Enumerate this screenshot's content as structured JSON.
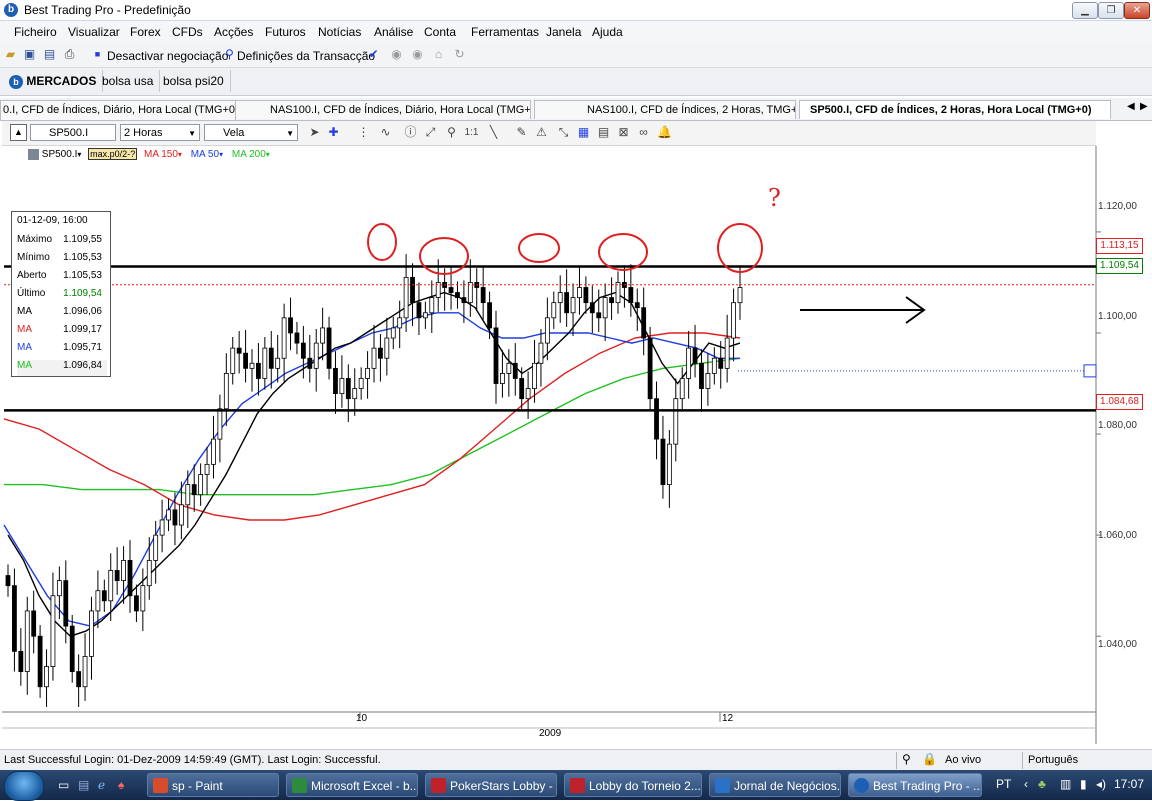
{
  "window": {
    "title": "Best Trading Pro - Predefinição",
    "app_logo": "b"
  },
  "menu": [
    "Ficheiro",
    "Visualizar",
    "Forex",
    "CFDs",
    "Acções",
    "Futuros",
    "Notícias",
    "Análise",
    "Conta",
    "Ferramentas",
    "Janela",
    "Ajuda"
  ],
  "toolbar": {
    "deactivate_label": "Desactivar negociação",
    "transaction_label": "Definições da Transacção"
  },
  "markets": {
    "logo_label": "MERCADOS",
    "tabs": [
      "bolsa usa",
      "bolsa psi20"
    ]
  },
  "chart_tabs": [
    "0.I, CFD de Índices, Diário, Hora Local (TMG+0)",
    "NAS100.I, CFD de Índices, Diário, Hora Local (TMG+0)",
    "NAS100.I, CFD de Índices, 2 Horas, TMG+0",
    "SP500.I, CFD de Índices, 2 Horas, Hora Local (TMG+0)"
  ],
  "chart_toolbar": {
    "symbol": "SP500.I",
    "timeframe": "2 Horas",
    "chart_type": "Vela"
  },
  "legend": {
    "symbol": "SP500.I",
    "overlay": "max.p0/2-?",
    "items": [
      {
        "label": "MA 20",
        "color": "#000000"
      },
      {
        "label": "MA 150",
        "color": "#e02020"
      },
      {
        "label": "MA 50",
        "color": "#1f3de0"
      },
      {
        "label": "MA 200",
        "color": "#20c020"
      }
    ]
  },
  "info": {
    "date": "01-12-09, 16:00",
    "rows": [
      {
        "label": "Máximo",
        "value": "1.109,55",
        "color": "#000000"
      },
      {
        "label": "Mínimo",
        "value": "1.105,53",
        "color": "#000000"
      },
      {
        "label": "Aberto",
        "value": "1.105,53",
        "color": "#000000"
      },
      {
        "label": "Último",
        "value": "1.109,54",
        "color": "#008000"
      },
      {
        "label": "MA",
        "value": "1.096,06",
        "color": "#000000"
      },
      {
        "label": "MA",
        "value": "1.099,17",
        "color": "#e02020"
      },
      {
        "label": "MA",
        "value": "1.095,71",
        "color": "#1f3de0"
      },
      {
        "label": "MA",
        "value": "1.096,84",
        "color": "#20c020"
      }
    ]
  },
  "price_axis": [
    "1.120,00",
    "1.100,00",
    "1.080,00",
    "1.060,00",
    "1.040,00"
  ],
  "price_markers": [
    {
      "value": "1.113,15",
      "color": "#e02020"
    },
    {
      "value": "1.109,54",
      "color": "#008000"
    },
    {
      "value": "1.084,68",
      "color": "#e02020"
    }
  ],
  "time_axis": {
    "labels": [
      "10",
      "12"
    ],
    "year": "2009"
  },
  "annotation": {
    "question": "?"
  },
  "status": {
    "login": "Last Successful Login: 01-Dez-2009 14:59:49 (GMT). Last Login: Successful.",
    "mode": "Ao vivo",
    "language": "Português"
  },
  "taskbar": {
    "items": [
      {
        "label": "sp - Paint",
        "color": "#d84c2c"
      },
      {
        "label": "Microsoft Excel - b...",
        "color": "#2e8b3e"
      },
      {
        "label": "PokerStars Lobby - ...",
        "color": "#c0222a"
      },
      {
        "label": "Lobby do Torneio 2...",
        "color": "#c0222a"
      },
      {
        "label": "Jornal de Negócios...",
        "color": "#2a72c8"
      },
      {
        "label": "Best Trading Pro - ...",
        "color": "#1e5fb4"
      }
    ],
    "lang": "PT",
    "clock": "17:07"
  },
  "chart_data": {
    "type": "candlestick",
    "symbol": "SP500.I",
    "timeframe": "2 Horas",
    "ylim": [
      1025,
      1137
    ],
    "resistance": 1113.15,
    "support": 1084.68,
    "last": 1109.54,
    "target_line": 1092.5,
    "closes": [
      1050,
      1037,
      1033,
      1045,
      1040,
      1030,
      1034,
      1048,
      1051,
      1042,
      1033,
      1030,
      1036,
      1045,
      1049,
      1047,
      1053,
      1051,
      1055,
      1048,
      1045,
      1050,
      1055,
      1060,
      1063,
      1065,
      1062,
      1066,
      1070,
      1068,
      1072,
      1074,
      1079,
      1085,
      1092,
      1097,
      1096,
      1093,
      1094,
      1091,
      1097,
      1093,
      1095,
      1103,
      1100,
      1098,
      1095,
      1093,
      1098,
      1101,
      1093,
      1088,
      1091,
      1087,
      1089,
      1091,
      1093,
      1097,
      1095,
      1099,
      1101,
      1103,
      1111,
      1106,
      1103,
      1104,
      1107,
      1110,
      1109,
      1108,
      1107,
      1106,
      1110,
      1109,
      1106,
      1101,
      1090,
      1092,
      1094,
      1091,
      1087,
      1089,
      1094,
      1098,
      1103,
      1106,
      1108,
      1104,
      1107,
      1109,
      1106,
      1104,
      1103,
      1107,
      1106,
      1110,
      1109,
      1106,
      1105,
      1099,
      1087,
      1079,
      1070,
      1078,
      1087,
      1091,
      1097,
      1094,
      1089,
      1092,
      1095,
      1093,
      1099,
      1106,
      1109
    ],
    "ma_black": [
      1060,
      1055,
      1048,
      1043,
      1040,
      1041,
      1043,
      1046,
      1049,
      1052,
      1055,
      1058,
      1062,
      1067,
      1072,
      1078,
      1084,
      1088,
      1091,
      1093,
      1095,
      1097,
      1098,
      1100,
      1102,
      1104,
      1106,
      1107,
      1108,
      1107,
      1105,
      1100,
      1095,
      1092,
      1094,
      1097,
      1100,
      1104,
      1107,
      1108,
      1106,
      1100,
      1094,
      1090,
      1094,
      1098,
      1097,
      1098
    ],
    "ma_blue": [
      1062,
      1055,
      1048,
      1043,
      1042,
      1045,
      1052,
      1060,
      1068,
      1075,
      1081,
      1086,
      1089,
      1092,
      1094,
      1096,
      1098,
      1100,
      1101,
      1103,
      1104,
      1104,
      1101,
      1099,
      1099,
      1100,
      1100,
      1100,
      1099,
      1098,
      1099,
      1098,
      1097,
      1095,
      1095
    ],
    "ma_red": [
      1083,
      1081,
      1077,
      1073,
      1070,
      1066,
      1064,
      1063,
      1063,
      1064,
      1066,
      1068,
      1070,
      1075,
      1081,
      1087,
      1092,
      1096,
      1099,
      1100,
      1100,
      1099
    ],
    "ma_green": [
      1070,
      1070,
      1069,
      1069,
      1069,
      1068,
      1068,
      1068,
      1068,
      1069,
      1070,
      1072,
      1076,
      1080,
      1084,
      1088,
      1091,
      1093,
      1094,
      1095
    ]
  }
}
